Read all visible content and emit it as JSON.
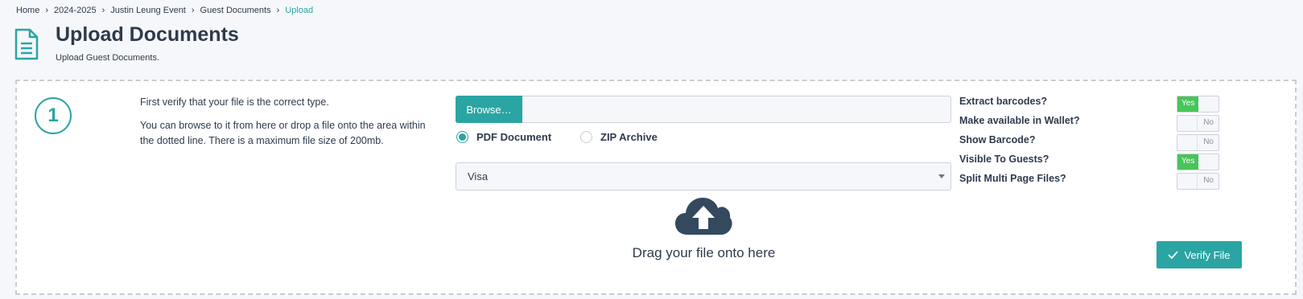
{
  "breadcrumb": {
    "items": [
      "Home",
      "2024-2025",
      "Justin Leung Event",
      "Guest Documents",
      "Upload"
    ]
  },
  "header": {
    "icon": "document-icon",
    "title": "Upload Documents",
    "subtitle": "Upload Guest Documents."
  },
  "step": {
    "number": "1",
    "instruction_1": "First verify that your file is the correct type.",
    "instruction_2": "You can browse to it from here or drop a file onto the area within the dotted line. There is a maximum file size of 200mb."
  },
  "file_input": {
    "browse_label": "Browse…",
    "value": ""
  },
  "file_type": {
    "options": [
      "PDF Document",
      "ZIP Archive"
    ],
    "selected": "PDF Document"
  },
  "document_type": {
    "selected": "Visa"
  },
  "dropzone": {
    "icon": "cloud-upload-icon",
    "text": "Drag your file onto here"
  },
  "options": [
    {
      "label": "Extract barcodes?",
      "value": "Yes",
      "on": true
    },
    {
      "label": "Make available in Wallet?",
      "value": "No",
      "on": false
    },
    {
      "label": "Show Barcode?",
      "value": "No",
      "on": false
    },
    {
      "label": "Visible To Guests?",
      "value": "Yes",
      "on": true
    },
    {
      "label": "Split Multi Page Files?",
      "value": "No",
      "on": false
    }
  ],
  "actions": {
    "verify_label": "Verify File"
  },
  "colors": {
    "accent": "#2aa5a3",
    "toggle_on": "#48c55a",
    "text": "#2e3b4c",
    "background": "#f5f7fa"
  }
}
